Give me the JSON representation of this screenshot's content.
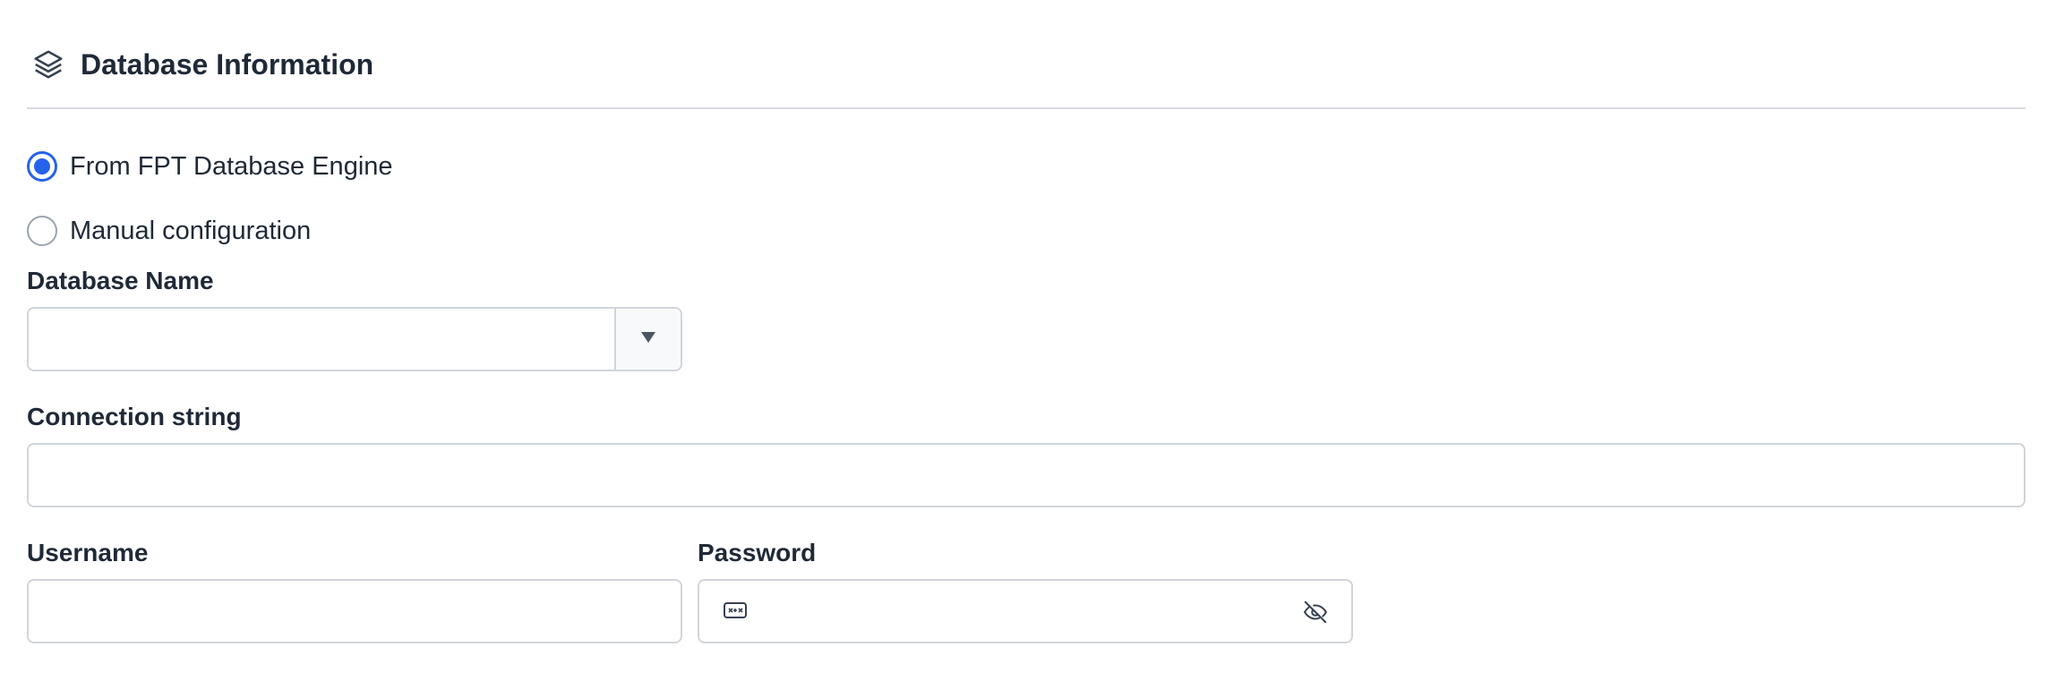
{
  "section": {
    "title": "Database Information",
    "icon": "layers-icon"
  },
  "source_options": [
    {
      "label": "From FPT Database Engine",
      "selected": true
    },
    {
      "label": "Manual configuration",
      "selected": false
    }
  ],
  "fields": {
    "database_name": {
      "label": "Database Name",
      "value": ""
    },
    "connection_string": {
      "label": "Connection string",
      "value": ""
    },
    "username": {
      "label": "Username",
      "value": ""
    },
    "password": {
      "label": "Password",
      "value": ""
    }
  },
  "colors": {
    "accent": "#2563eb",
    "border": "#d1d5db",
    "text": "#1f2937"
  }
}
